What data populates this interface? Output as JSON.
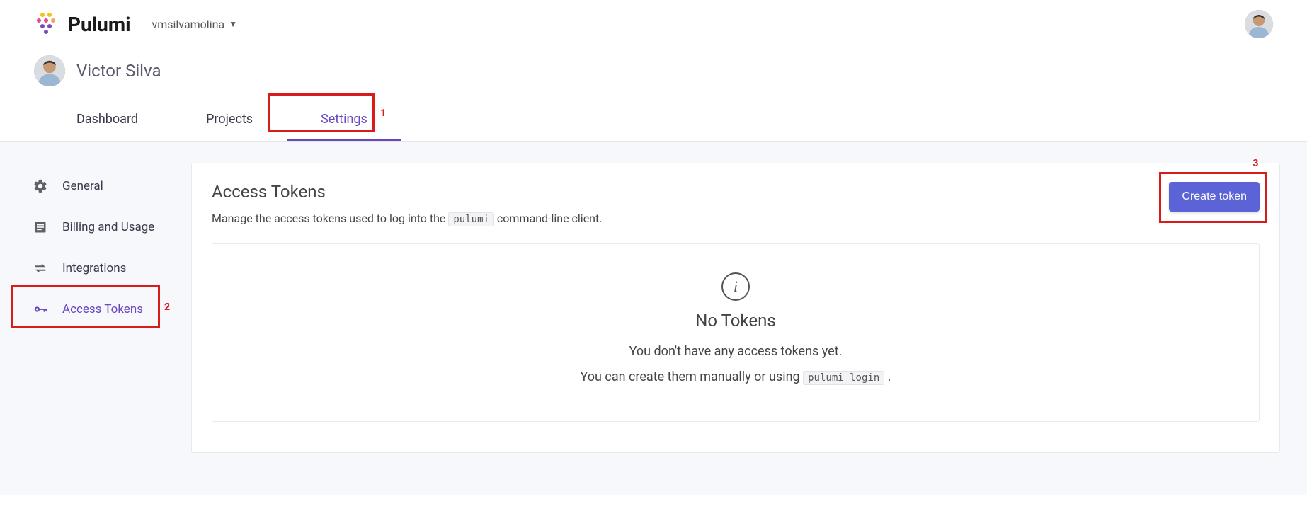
{
  "brand": {
    "name": "Pulumi"
  },
  "org_picker": {
    "selected": "vmsilvamolina"
  },
  "user": {
    "display_name": "Victor Silva"
  },
  "tabs": [
    {
      "label": "Dashboard",
      "active": false
    },
    {
      "label": "Projects",
      "active": false
    },
    {
      "label": "Settings",
      "active": true
    }
  ],
  "sidebar": {
    "items": [
      {
        "label": "General",
        "icon": "gear-icon",
        "active": false
      },
      {
        "label": "Billing and Usage",
        "icon": "list-icon",
        "active": false
      },
      {
        "label": "Integrations",
        "icon": "swap-icon",
        "active": false
      },
      {
        "label": "Access Tokens",
        "icon": "key-icon",
        "active": true
      }
    ]
  },
  "panel": {
    "title": "Access Tokens",
    "desc_pre": "Manage the access tokens used to log into the ",
    "desc_code": "pulumi",
    "desc_post": " command-line client.",
    "create_btn": "Create token",
    "empty": {
      "heading": "No Tokens",
      "line1": "You don't have any access tokens yet.",
      "line2_pre": "You can create them manually or using ",
      "line2_code": "pulumi login",
      "line2_post": " ."
    }
  },
  "annotations": {
    "a1": "1",
    "a2": "2",
    "a3": "3"
  }
}
